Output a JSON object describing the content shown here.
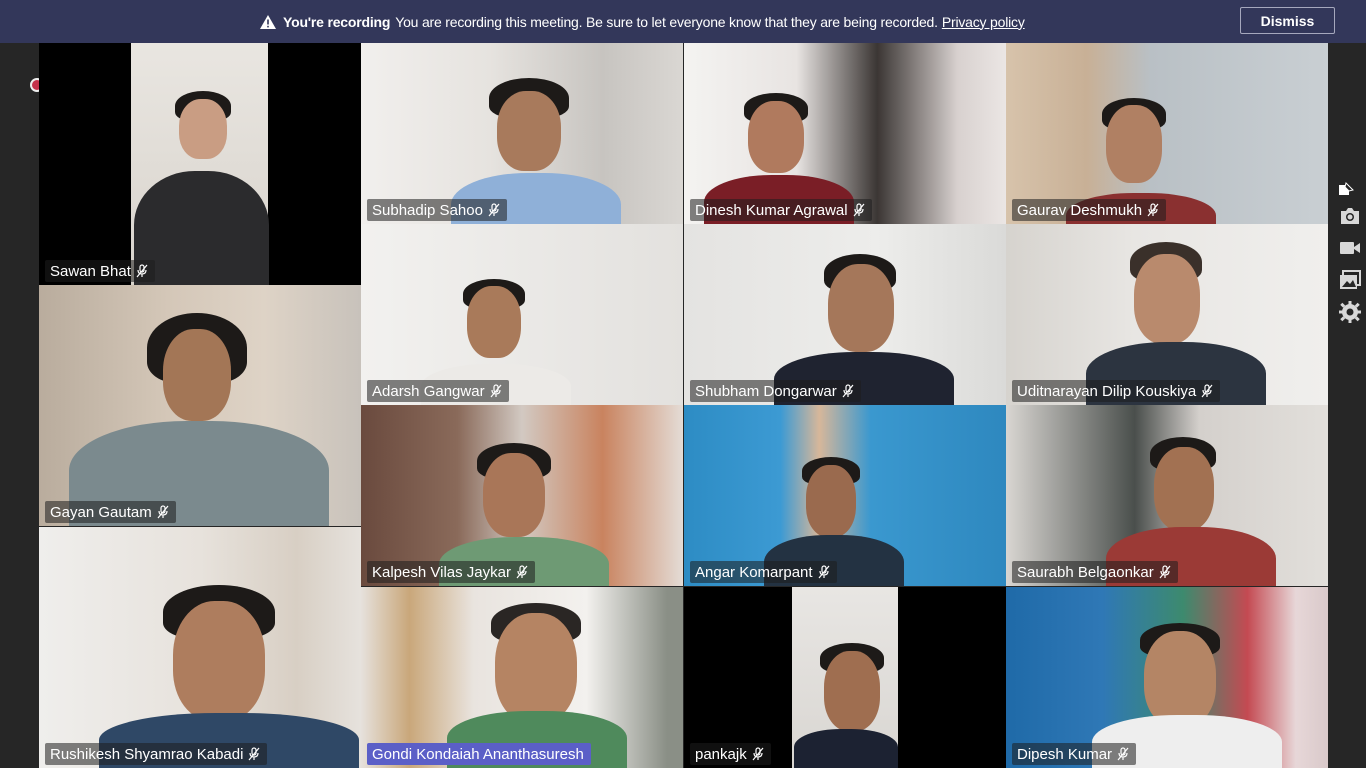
{
  "banner": {
    "title": "You're recording",
    "message": "You are recording this meeting. Be sure to let everyone know that they are being recorded.",
    "link": "Privacy policy",
    "dismiss_label": "Dismiss",
    "icon": "warning-icon"
  },
  "participants": [
    {
      "name": "Sawan Bhat",
      "muted": true
    },
    {
      "name": "Subhadip Sahoo",
      "muted": true
    },
    {
      "name": "Dinesh Kumar Agrawal",
      "muted": true
    },
    {
      "name": "Gaurav Deshmukh",
      "muted": true
    },
    {
      "name": "Adarsh Gangwar",
      "muted": true
    },
    {
      "name": "Shubham Dongarwar",
      "muted": true
    },
    {
      "name": "Uditnarayan Dilip Kouskiya",
      "muted": true
    },
    {
      "name": "Gayan Gautam",
      "muted": true
    },
    {
      "name": "Kalpesh Vilas Jaykar",
      "muted": true
    },
    {
      "name": "Angar Komarpant",
      "muted": true
    },
    {
      "name": "Saurabh Belgaonkar",
      "muted": true
    },
    {
      "name": "Rushikesh Shyamrao Kabadi",
      "muted": true
    },
    {
      "name": "Gondi Kondaiah Ananthasuresh",
      "muted": false,
      "speaking": true
    },
    {
      "name": "pankajk",
      "muted": true
    },
    {
      "name": "Dipesh Kumar",
      "muted": true
    }
  ],
  "side_toolbar": [
    "pin-icon",
    "camera-icon",
    "video-icon",
    "gallery-icon",
    "settings-icon"
  ],
  "colors": {
    "banner_bg": "#33375a",
    "active_speaker": "#5b5fc7",
    "recording": "#c4314b"
  }
}
